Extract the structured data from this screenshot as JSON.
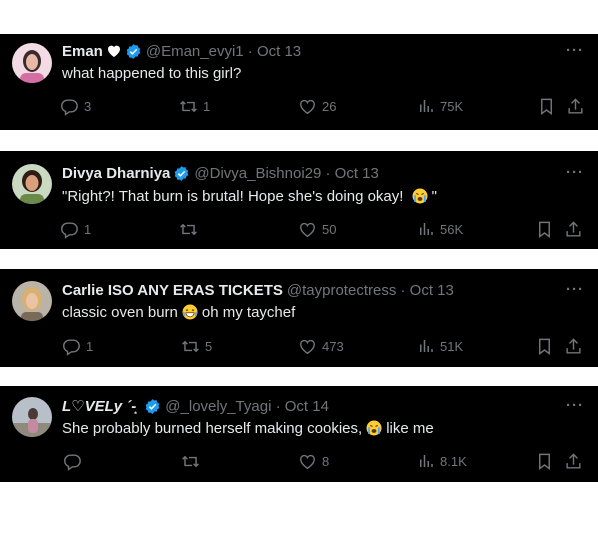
{
  "colors": {
    "background": "#000000",
    "text": "#e7e9ea",
    "muted": "#71767b",
    "verified": "#1d9bf0"
  },
  "tweets": [
    {
      "name": "Eman",
      "name_suffix_icon": "white-heart-emoji",
      "verified": true,
      "handle": "@Eman_evyi1 · Oct 13",
      "text": "what happened to this girl?",
      "replies": "3",
      "retweets": "1",
      "likes": "26",
      "views": "75K"
    },
    {
      "name": "Divya Dharniya",
      "verified": true,
      "handle": "@Divya_Bishnoi29 · Oct 13",
      "text": "\"Right?! That burn is brutal! Hope she's doing okay! ",
      "text_end": "\"",
      "replies": "1",
      "retweets": "",
      "likes": "50",
      "views": "56K"
    },
    {
      "name": "Carlie ISO ANY ERAS TICKETS",
      "verified": false,
      "handle": "@tayprotectress · Oct 13",
      "text": "classic oven burn",
      "text_end": "oh my taychef",
      "replies": "1",
      "retweets": "5",
      "likes": "473",
      "views": "51K"
    },
    {
      "name": "L♡VELy ´-͙",
      "verified": true,
      "handle": "@_lovely_Tyagi · Oct 14",
      "text": "She probably burned herself making cookies,",
      "text_end": "like me",
      "replies": "",
      "retweets": "",
      "likes": "8",
      "views": "8.1K"
    }
  ],
  "more_label": "···"
}
